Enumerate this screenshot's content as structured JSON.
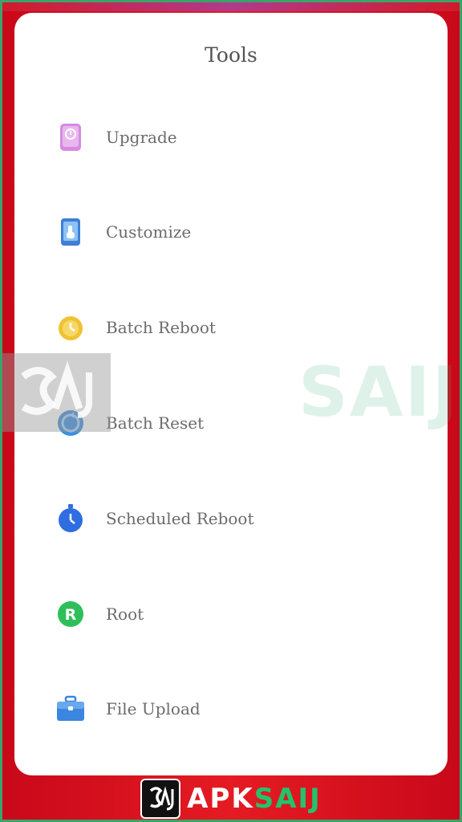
{
  "header": {
    "title": "Tools"
  },
  "tools": [
    {
      "label": "Upgrade",
      "icon": "upgrade-icon",
      "color": "#d58be0"
    },
    {
      "label": "Customize",
      "icon": "customize-icon",
      "color": "#3f7fd6"
    },
    {
      "label": "Batch Reboot",
      "icon": "batch-reboot-icon",
      "color": "#f0c232"
    },
    {
      "label": "Batch Reset",
      "icon": "batch-reset-icon",
      "color": "#3e8fe0"
    },
    {
      "label": "Scheduled Reboot",
      "icon": "scheduled-reboot-icon",
      "color": "#2f6ee0"
    },
    {
      "label": "Root",
      "icon": "root-icon",
      "color": "#2fbf5a"
    },
    {
      "label": "File Upload",
      "icon": "file-upload-icon",
      "color": "#3b86e0"
    }
  ],
  "watermark": {
    "text": "SAIJ"
  },
  "branding": {
    "apk": "APK",
    "saij": "SAIJ"
  }
}
